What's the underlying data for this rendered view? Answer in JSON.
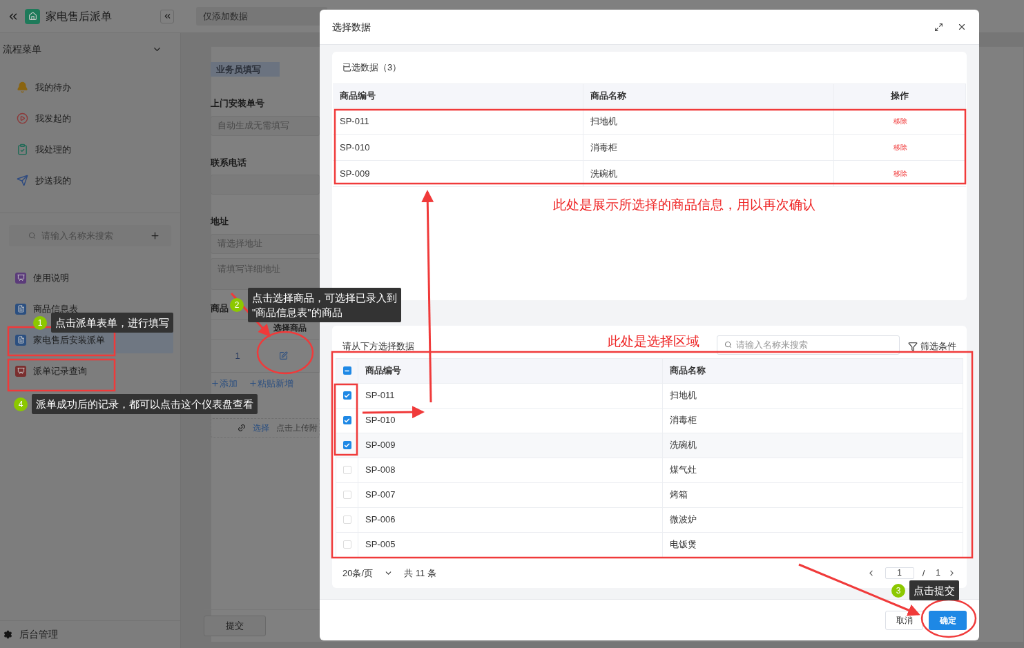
{
  "topbar": {
    "app_title": "家电售后派单",
    "view_select": "仅添加数据"
  },
  "sidebar": {
    "menu_title": "流程菜单",
    "flow_items": [
      {
        "label": "我的待办",
        "kind": "bell"
      },
      {
        "label": "我发起的",
        "kind": "play"
      },
      {
        "label": "我处理的",
        "kind": "done"
      },
      {
        "label": "抄送我的",
        "kind": "send"
      }
    ],
    "search": {
      "placeholder": "请输入名称来搜索"
    },
    "forms": [
      {
        "label": "使用说明",
        "kind": "guide",
        "selected": false
      },
      {
        "label": "商品信息表",
        "kind": "sheet",
        "selected": false
      },
      {
        "label": "家电售后安装派单",
        "kind": "sheet",
        "selected": true
      },
      {
        "label": "派单记录查询",
        "kind": "dashboard",
        "selected": false
      }
    ],
    "footer": "后台管理"
  },
  "form": {
    "section": "业务员填写",
    "fields": [
      {
        "label": "上门安装单号",
        "inputs": [
          {
            "kind": "line",
            "placeholder": "自动生成无需填写"
          }
        ]
      },
      {
        "label": "联系电话",
        "inputs": [
          {
            "kind": "line"
          }
        ]
      },
      {
        "label": "地址",
        "inputs": [
          {
            "kind": "line",
            "placeholder": "请选择地址"
          },
          {
            "kind": "area",
            "placeholder": "请填写详细地址"
          }
        ]
      }
    ],
    "goods": {
      "label": "商品",
      "column": "选择商品",
      "row_index": "1",
      "actions": [
        "添加",
        "粘贴新增"
      ]
    },
    "upload": {
      "link": "选择",
      "hint": "点击上传附"
    },
    "submit": "提交"
  },
  "modal": {
    "title": "选择数据",
    "selected": {
      "title": "已选数据（3）",
      "columns": [
        "商品编号",
        "商品名称",
        "操作"
      ],
      "rows": [
        {
          "code": "SP-011",
          "name": "扫地机",
          "action": "移除"
        },
        {
          "code": "SP-010",
          "name": "消毒柜",
          "action": "移除"
        },
        {
          "code": "SP-009",
          "name": "洗碗机",
          "action": "移除"
        }
      ]
    },
    "picker": {
      "title": "请从下方选择数据",
      "search_placeholder": "请输入名称来搜索",
      "filter": "筛选条件",
      "header_checkbox_indeterminate": true,
      "columns": [
        "商品编号",
        "商品名称"
      ],
      "rows": [
        {
          "code": "SP-011",
          "name": "扫地机",
          "checked": true
        },
        {
          "code": "SP-010",
          "name": "消毒柜",
          "checked": true
        },
        {
          "code": "SP-009",
          "name": "洗碗机",
          "checked": true
        },
        {
          "code": "SP-008",
          "name": "煤气灶",
          "checked": false
        },
        {
          "code": "SP-007",
          "name": "烤箱",
          "checked": false
        },
        {
          "code": "SP-006",
          "name": "微波炉",
          "checked": false
        },
        {
          "code": "SP-005",
          "name": "电饭煲",
          "checked": false
        }
      ],
      "page_size": "20条/页",
      "total": "共 11 条",
      "page": "1",
      "separator": "/",
      "pages": "1"
    },
    "cancel": "取消",
    "ok": "确定"
  },
  "notes": [
    "此处是展示所选择的商品信息，用以再次确认",
    "此处是选择区域"
  ],
  "tips": [
    {
      "number": "1",
      "lines": [
        "点击派单表单，进行填写"
      ]
    },
    {
      "number": "2",
      "lines": [
        "点击选择商品，可选择已录入到",
        "\"商品信息表\"的商品"
      ]
    },
    {
      "number": "3",
      "lines": [
        "点击提交"
      ]
    },
    {
      "number": "4",
      "lines": [
        "派单成功后的记录，都可以点击这个仪表盘查看"
      ]
    }
  ]
}
